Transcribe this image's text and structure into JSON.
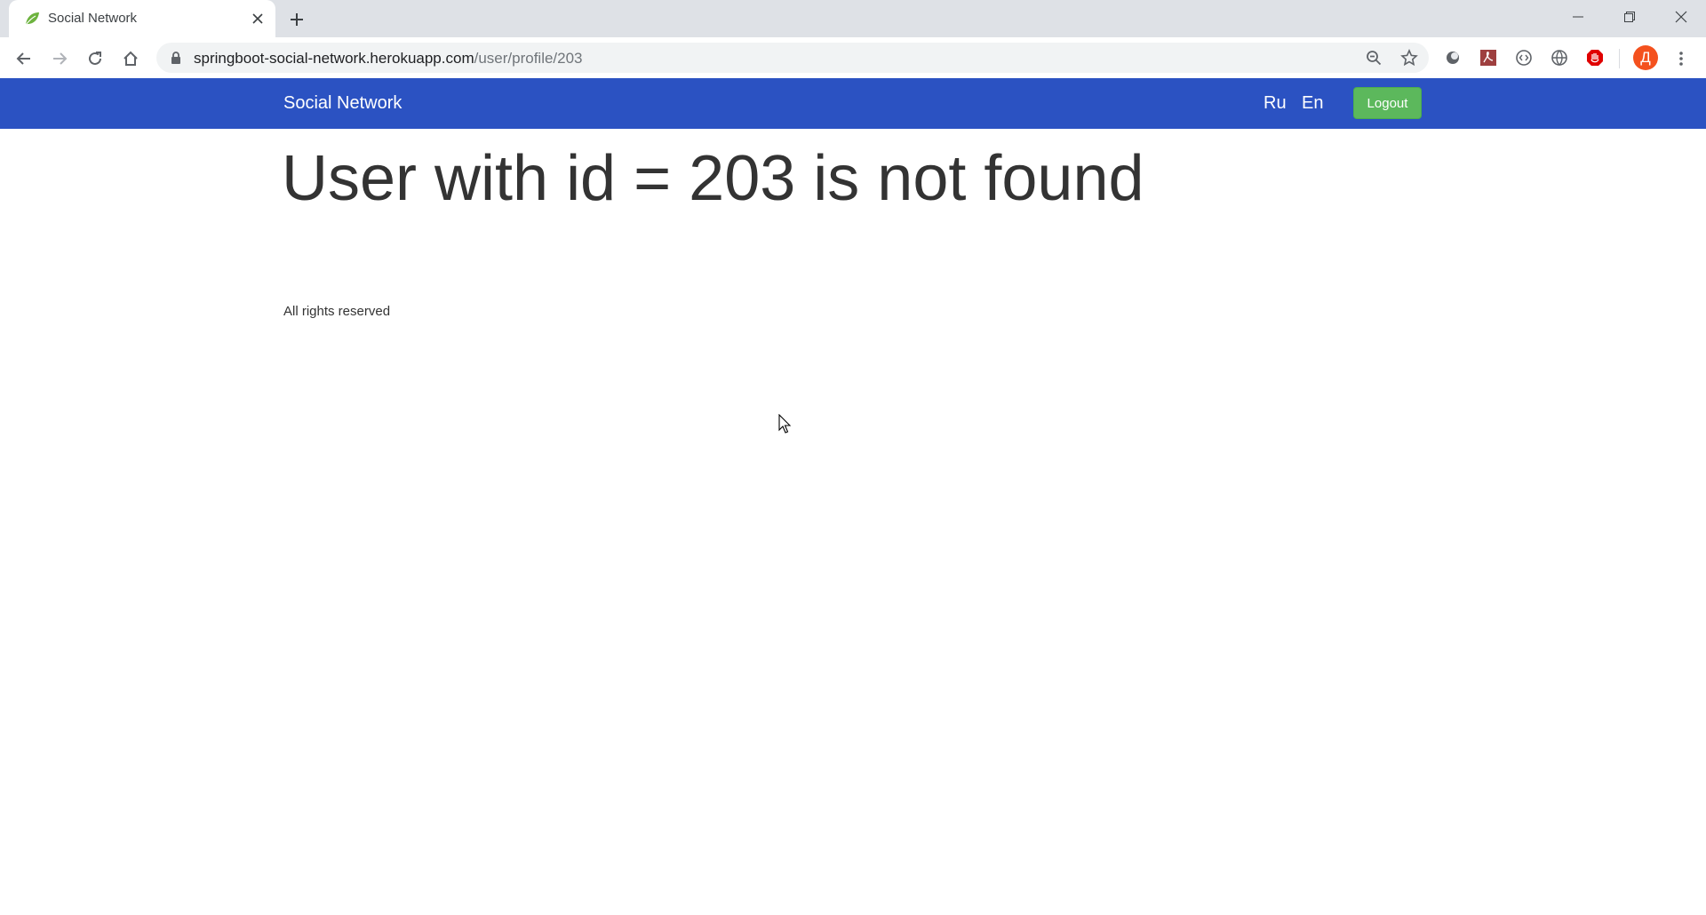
{
  "browser": {
    "tab_title": "Social Network",
    "url_host": "springboot-social-network.herokuapp.com",
    "url_path": "/user/profile/203",
    "profile_initial": "Д"
  },
  "navbar": {
    "brand": "Social Network",
    "lang_ru": "Ru",
    "lang_en": "En",
    "logout_label": "Logout"
  },
  "main": {
    "heading": "User with id = 203 is not found"
  },
  "footer": {
    "text": "All rights reserved"
  },
  "colors": {
    "navbar_bg": "#2b52c2",
    "logout_bg": "#5cb85c",
    "avatar_bg": "#f4511e"
  }
}
